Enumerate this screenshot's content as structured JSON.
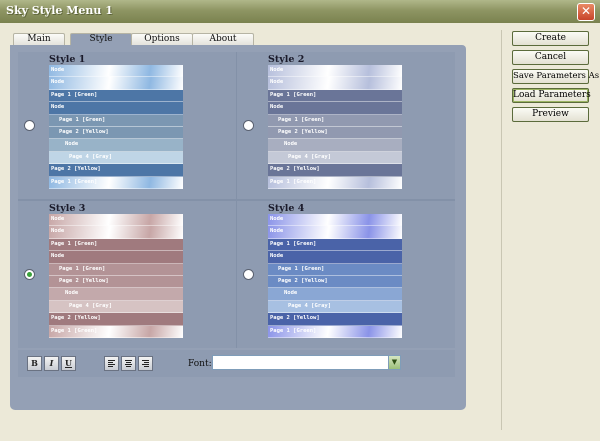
{
  "window": {
    "title": "Sky Style Menu 1",
    "close_label": "✕"
  },
  "tabs": [
    {
      "label": "Main"
    },
    {
      "label": "Style"
    },
    {
      "label": "Options"
    },
    {
      "label": "About"
    }
  ],
  "styles": [
    {
      "title": "Style 1",
      "selected": false,
      "colors": {
        "header": "#8fb8e2",
        "selected": "#4d76a6",
        "sub": "#7b97b2",
        "subsub": "#98b3c8",
        "light": "#bfd5e6",
        "footer": "#8fb8e2"
      },
      "rows": [
        "Node",
        "Node",
        "Page 1 [Green]",
        "Node",
        "Page 1 [Green]",
        "Page 2 [Yellow]",
        "Node",
        "Page 4 [Gray]",
        "Page 2 [Yellow]",
        "Page 1 [Green]"
      ]
    },
    {
      "title": "Style 2",
      "selected": false,
      "colors": {
        "header": "#b6bfdc",
        "selected": "#6a7598",
        "sub": "#9199b0",
        "subsub": "#a8aec0",
        "light": "#c4c9d7",
        "footer": "#b6bfdc"
      },
      "rows": [
        "Node",
        "Node",
        "Page 1 [Green]",
        "Node",
        "Page 1 [Green]",
        "Page 2 [Yellow]",
        "Node",
        "Page 4 [Gray]",
        "Page 2 [Yellow]",
        "Page 1 [Green]"
      ]
    },
    {
      "title": "Style 3",
      "selected": true,
      "colors": {
        "header": "#c7a6a6",
        "selected": "#a07a7e",
        "sub": "#b39396",
        "subsub": "#c3a9ab",
        "light": "#d6c3c3",
        "footer": "#c7a6a6"
      },
      "rows": [
        "Node",
        "Node",
        "Page 1 [Green]",
        "Node",
        "Page 1 [Green]",
        "Page 2 [Yellow]",
        "Node",
        "Page 4 [Gray]",
        "Page 2 [Yellow]",
        "Page 1 [Green]"
      ]
    },
    {
      "title": "Style 4",
      "selected": false,
      "colors": {
        "header": "#8a93e8",
        "selected": "#4a63a8",
        "sub": "#6b8bc4",
        "subsub": "#8aa7d4",
        "light": "#a7c0e2",
        "footer": "#8a93e8"
      },
      "rows": [
        "Node",
        "Node",
        "Page 1 [Green]",
        "Node",
        "Page 1 [Green]",
        "Page 2 [Yellow]",
        "Node",
        "Page 4 [Gray]",
        "Page 2 [Yellow]",
        "Page 1 [Green]"
      ]
    }
  ],
  "toolbar": {
    "bold_label": "B",
    "italic_label": "I",
    "underline_label": "U",
    "font_label": "Font:",
    "font_value": ""
  },
  "side_buttons": {
    "create": "Create",
    "cancel": "Cancel",
    "save_params": "Save Parameters As",
    "load_params": "Load Parameters",
    "preview": "Preview"
  }
}
